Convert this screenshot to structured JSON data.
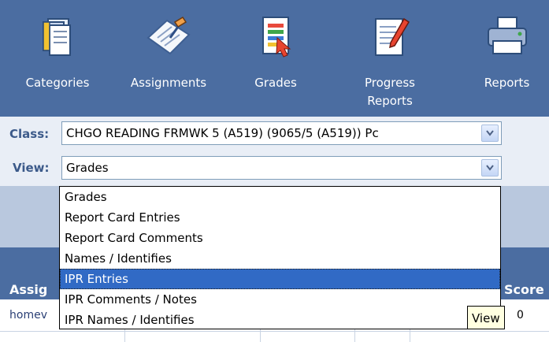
{
  "toolbar": {
    "items": [
      {
        "label": "Categories",
        "icon": "categories-icon"
      },
      {
        "label": "Assignments",
        "icon": "assignments-icon"
      },
      {
        "label": "Grades",
        "icon": "grades-icon"
      },
      {
        "label": "Progress Reports",
        "icon": "progress-reports-icon"
      },
      {
        "label": "Reports",
        "icon": "reports-printer-icon"
      }
    ]
  },
  "filters": {
    "class_label": "Class:",
    "class_value": "CHGO READING FRMWK 5 (A519) (9065/5 (A519)) Pc",
    "view_label": "View:",
    "view_value": "Grades"
  },
  "view_dropdown": {
    "options": [
      "Grades",
      "Report Card Entries",
      "Report Card Comments",
      "Names / Identifies",
      "IPR Entries",
      "IPR Comments / Notes",
      "IPR Names / Identifies"
    ],
    "selected": "IPR Entries"
  },
  "grid": {
    "header_left": "Assig",
    "header_right": "Score",
    "row_left": "homev",
    "row_right": "0"
  },
  "tooltip": {
    "text": "View"
  },
  "colors": {
    "toolbar_bg": "#4b6da1",
    "selected_option": "#316ac5"
  }
}
